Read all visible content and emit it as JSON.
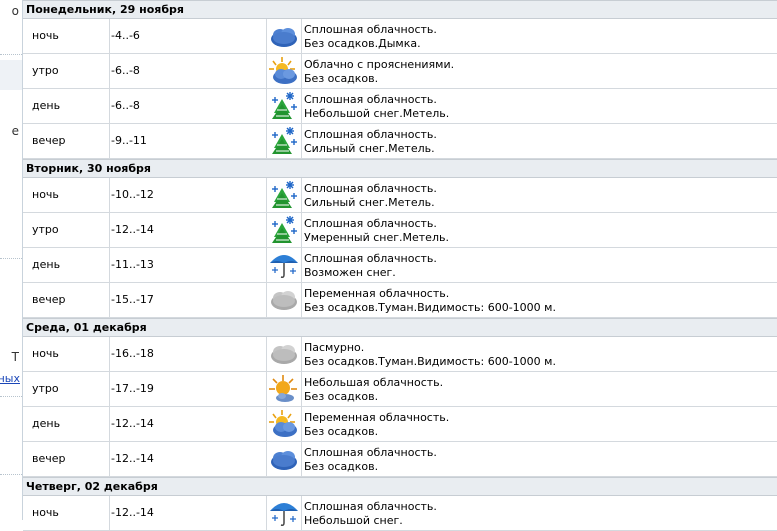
{
  "sidebar": {
    "fragment_1": "о",
    "fragment_2": "е",
    "fragment_3": "Т",
    "fragment_4": "ных"
  },
  "days": [
    {
      "title": "Понедельник, 29 ноября",
      "rows": [
        {
          "time": "ночь",
          "temp": "-4..-6",
          "icon": "cloud-icon",
          "line1": "Сплошная облачность.",
          "line2": "Без осадков.Дымка."
        },
        {
          "time": "утро",
          "temp": "-6..-8",
          "icon": "sun-cloud-icon",
          "line1": "Облачно с прояснениями.",
          "line2": "Без осадков."
        },
        {
          "time": "день",
          "temp": "-6..-8",
          "icon": "snow-blizzard-icon",
          "line1": "Сплошная облачность.",
          "line2": "Небольшой снег.Метель."
        },
        {
          "time": "вечер",
          "temp": "-9..-11",
          "icon": "snow-blizzard-icon",
          "line1": "Сплошная облачность.",
          "line2": "Сильный снег.Метель."
        }
      ]
    },
    {
      "title": "Вторник, 30 ноября",
      "rows": [
        {
          "time": "ночь",
          "temp": "-10..-12",
          "icon": "snow-blizzard-icon",
          "line1": "Сплошная облачность.",
          "line2": "Сильный снег.Метель."
        },
        {
          "time": "утро",
          "temp": "-12..-14",
          "icon": "snow-blizzard-icon",
          "line1": "Сплошная облачность.",
          "line2": "Умеренный снег.Метель."
        },
        {
          "time": "день",
          "temp": "-11..-13",
          "icon": "umbrella-snow-icon",
          "line1": "Сплошная облачность.",
          "line2": "Возможен снег."
        },
        {
          "time": "вечер",
          "temp": "-15..-17",
          "icon": "fog-cloud-icon",
          "line1": "Переменная облачность.",
          "line2": "Без осадков.Туман.Видимость: 600-1000 м."
        }
      ]
    },
    {
      "title": "Среда, 01 декабря",
      "rows": [
        {
          "time": "ночь",
          "temp": "-16..-18",
          "icon": "fog-cloud-icon",
          "line1": "Пасмурно.",
          "line2": "Без осадков.Туман.Видимость: 600-1000 м."
        },
        {
          "time": "утро",
          "temp": "-17..-19",
          "icon": "sun-small-cloud-icon",
          "line1": "Небольшая облачность.",
          "line2": "Без осадков."
        },
        {
          "time": "день",
          "temp": "-12..-14",
          "icon": "sun-cloud-icon",
          "line1": "Переменная облачность.",
          "line2": "Без осадков."
        },
        {
          "time": "вечер",
          "temp": "-12..-14",
          "icon": "cloud-icon",
          "line1": "Сплошная облачность.",
          "line2": "Без осадков."
        }
      ]
    },
    {
      "title": "Четверг, 02 декабря",
      "rows": [
        {
          "time": "ночь",
          "temp": "-12..-14",
          "icon": "umbrella-snow-icon",
          "line1": "Сплошная облачность.",
          "line2": "Небольшой снег."
        }
      ]
    }
  ]
}
